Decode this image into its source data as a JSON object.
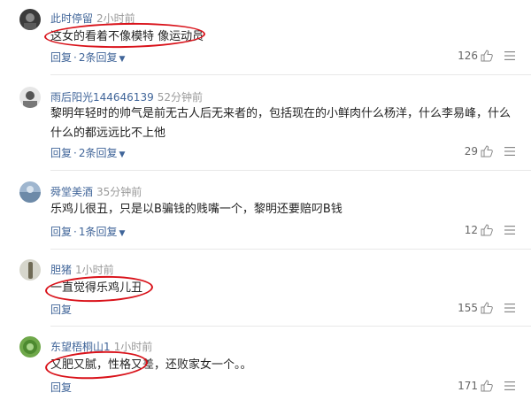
{
  "comments": [
    {
      "user": "此时停留",
      "time": "2小时前",
      "text": "这女的看着不像模特 像运动员",
      "reply_label": "回复",
      "reply_count": "2条回复",
      "likes": "126"
    },
    {
      "user": "雨后阳光144646139",
      "time": "52分钟前",
      "text": "黎明年轻时的帅气是前无古人后无来者的，包括现在的小鲜肉什么杨洋，什么李易峰，什么什么的都远远比不上他",
      "reply_label": "回复",
      "reply_count": "2条回复",
      "likes": "29"
    },
    {
      "user": "舜堂美酒",
      "time": "35分钟前",
      "text": "乐鸡儿很丑，只是以B骗钱的贱嘴一个，黎明还要赔叼B钱",
      "reply_label": "回复",
      "reply_count": "1条回复",
      "likes": "12"
    },
    {
      "user": "胆猪",
      "time": "1小时前",
      "text": "一直觉得乐鸡儿丑",
      "reply_label": "回复",
      "likes": "155"
    },
    {
      "user": "东望梧桐山1",
      "time": "1小时前",
      "text": "又肥又腻，性格又差，还败家女一个。。",
      "reply_label": "回复",
      "likes": "171"
    }
  ],
  "icons": {
    "like": "thumbs-up-icon",
    "menu": "hamburger-menu-icon",
    "dropdown": "chevron-down-icon"
  },
  "colors": {
    "username": "#406599",
    "time": "#999999",
    "highlight": "#d9121a"
  }
}
